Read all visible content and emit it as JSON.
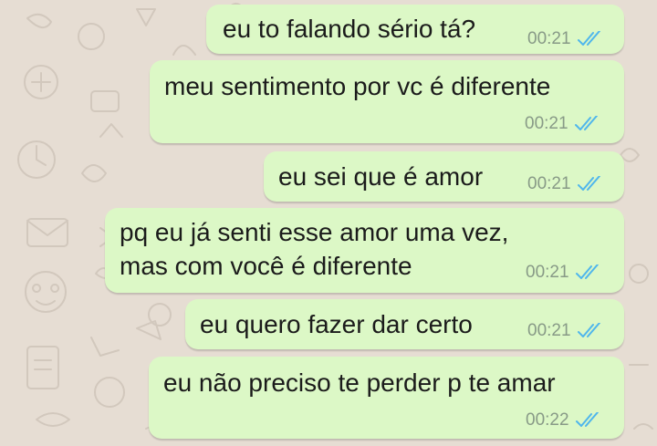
{
  "chat": {
    "read_tick_color": "#4fb6ec",
    "bubble_color": "#dcf8c6",
    "messages": [
      {
        "text": "eu to falando sério tá?",
        "time": "00:21",
        "status_icon": "double-check-read-icon"
      },
      {
        "text": "meu sentimento por vc é diferente",
        "time": "00:21",
        "status_icon": "double-check-read-icon"
      },
      {
        "text": "eu sei que é amor",
        "time": "00:21",
        "status_icon": "double-check-read-icon"
      },
      {
        "text_line1": "pq eu já senti esse amor uma vez,",
        "text_line2": "mas com você é diferente",
        "time": "00:21",
        "status_icon": "double-check-read-icon"
      },
      {
        "text": "eu quero fazer dar certo",
        "time": "00:21",
        "status_icon": "double-check-read-icon"
      },
      {
        "text": "eu não preciso te perder p te amar",
        "time": "00:22",
        "status_icon": "double-check-read-icon"
      }
    ]
  }
}
